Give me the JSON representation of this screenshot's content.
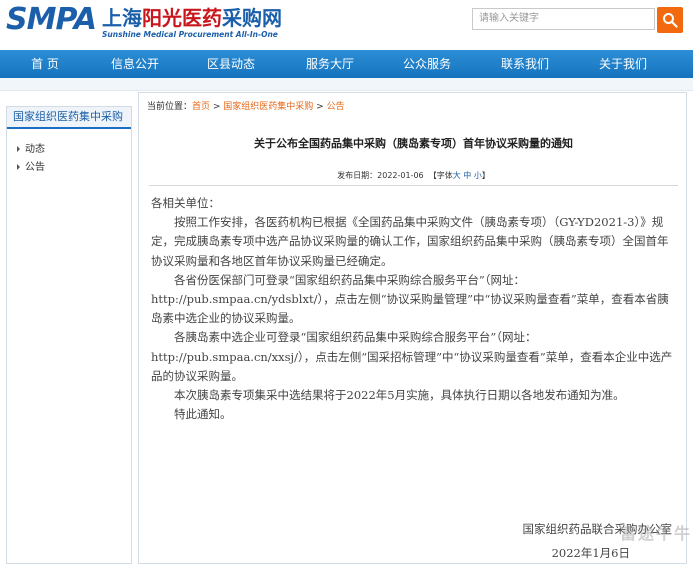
{
  "header": {
    "logo_mark": "SMPA",
    "logo_cn_1": "上海",
    "logo_cn_2": "阳光",
    "logo_cn_3": "医药",
    "logo_cn_4": "采购网",
    "logo_en": "Sunshine Medical Procurement All-In-One",
    "search_placeholder": "请输入关键字"
  },
  "nav": [
    "首 页",
    "信息公开",
    "区县动态",
    "服务大厅",
    "公众服务",
    "联系我们",
    "关于我们"
  ],
  "sidebar": {
    "title": "国家组织医药集中采购",
    "items": [
      "动态",
      "公告"
    ]
  },
  "breadcrumb": {
    "prefix": "当前位置：",
    "home": "首页",
    "sep": " > ",
    "section": "国家组织医药集中采购",
    "page": "公告"
  },
  "article": {
    "title": "关于公布全国药品集中采购（胰岛素专项）首年协议采购量的通知",
    "date_label": "发布日期：",
    "date": "2022-01-06",
    "font_label": "【字体",
    "font_big": "大",
    "font_mid": "中",
    "font_small": "小",
    "font_end": "】",
    "salutation": "各相关单位：",
    "paragraphs": [
      "按照工作安排，各医药机构已根据《全国药品集中采购文件（胰岛素专项）（GY-YD2021-3）》规定，完成胰岛素专项中选产品协议采购量的确认工作，国家组织药品集中采购（胰岛素专项）全国首年协议采购量和各地区首年协议采购量已经确定。",
      "各省份医保部门可登录“国家组织药品集中采购综合服务平台”（网址：http://pub.smpaa.cn/ydsblxt/），点击左侧“协议采购量管理”中“协议采购量查看”菜单，查看本省胰岛素中选企业的协议采购量。",
      "各胰岛素中选企业可登录“国家组织药品集中采购综合服务平台”（网址：http://pub.smpaa.cn/xxsj/），点击左侧“国采招标管理”中“协议采购量查看”菜单，查看本企业中选产品的协议采购量。",
      "本次胰岛素专项集采中选结果将于2022年5月实施，具体执行日期以各地发布通知为准。",
      "特此通知。"
    ],
    "signature": "国家组织药品联合采购办公室",
    "sign_date": "2022年1月6日"
  },
  "watermark": "富途牛牛"
}
